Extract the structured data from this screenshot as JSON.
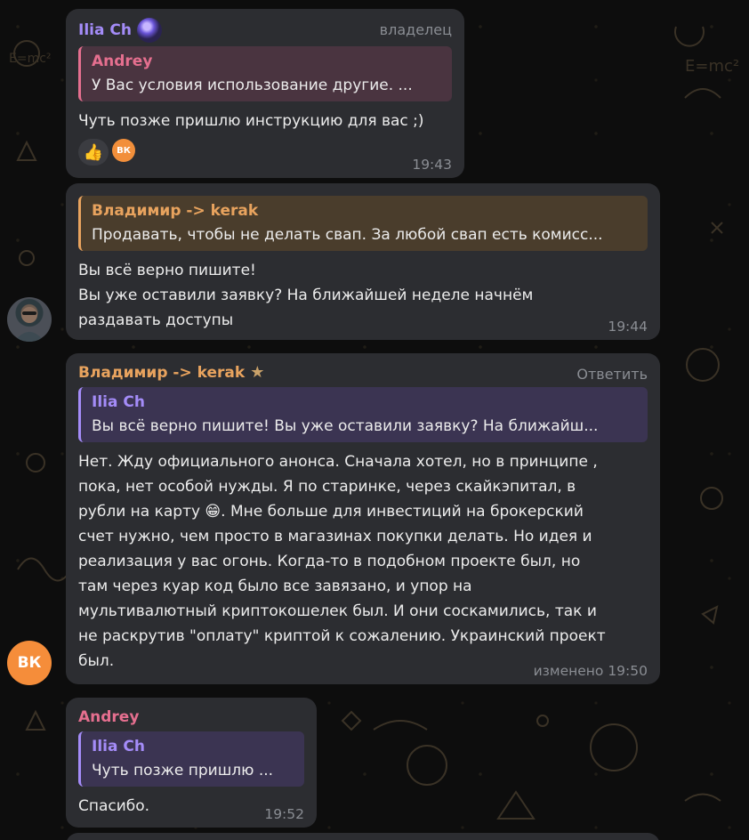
{
  "colors": {
    "bubble": "#2c2d31",
    "ilia": "#a48cf8",
    "andrey": "#e56f8f",
    "vladimir": "#e8a35e",
    "meta": "#8a8d93",
    "vk_orange": "#f58d3a"
  },
  "messages": [
    {
      "sender": "Ilia Ch",
      "role": "владелец",
      "reply": {
        "name": "Andrey",
        "text": "У Вас условия использование другие. ..."
      },
      "body": "Чуть позже пришлю инструкцию для вас ;)",
      "reactions": [
        "👍",
        "ВК"
      ],
      "time": "19:43"
    },
    {
      "reply": {
        "name": "Владимир -> kerak",
        "text": "Продавать, чтобы не делать свап. За любой свап есть комисс..."
      },
      "body_lines": [
        "Вы всё верно пишите!",
        "Вы уже оставили заявку? На ближайшей неделе начнём",
        "раздавать доступы"
      ],
      "time": "19:44"
    },
    {
      "sender": "Владимир -> kerak",
      "action": "Ответить",
      "reply": {
        "name": "Ilia Ch",
        "text": "Вы всё верно пишите! Вы уже оставили заявку? На ближайш..."
      },
      "body_lines": [
        "Нет. Жду официального анонса. Сначала хотел, но в принципе ,",
        "пока, нет особой нужды. Я по старинке, через скайкэпитал, в",
        "рубли на карту 😁. Мне больше для инвестиций на брокерский",
        "счет нужно, чем просто в магазинах покупки делать. Но идея и",
        "реализация  у вас огонь. Когда-то в подобном проекте был, но",
        "там через куар код было все завязано, и упор на",
        "мультивалютный криптокошелек был. И они соскамились, так и",
        "не раскрутив \"оплату\" криптой к сожалению. Украинский проект",
        "был."
      ],
      "time": "изменено 19:50"
    },
    {
      "sender": "Andrey",
      "reply": {
        "name": "Ilia Ch",
        "text": "Чуть позже пришлю ..."
      },
      "body": "Спасибо.",
      "time": "19:52"
    }
  ],
  "avatars": {
    "vk_label": "ВК",
    "photo_icon": "user-photo"
  }
}
